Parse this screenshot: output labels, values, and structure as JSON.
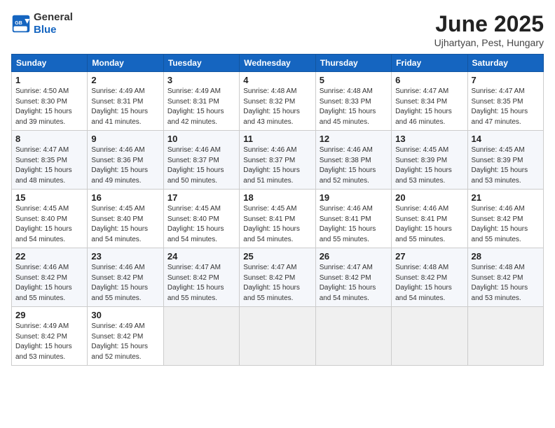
{
  "logo": {
    "text_general": "General",
    "text_blue": "Blue"
  },
  "title": "June 2025",
  "subtitle": "Ujhartyan, Pest, Hungary",
  "weekdays": [
    "Sunday",
    "Monday",
    "Tuesday",
    "Wednesday",
    "Thursday",
    "Friday",
    "Saturday"
  ],
  "weeks": [
    [
      {
        "day": "1",
        "info": "Sunrise: 4:50 AM\nSunset: 8:30 PM\nDaylight: 15 hours\nand 39 minutes."
      },
      {
        "day": "2",
        "info": "Sunrise: 4:49 AM\nSunset: 8:31 PM\nDaylight: 15 hours\nand 41 minutes."
      },
      {
        "day": "3",
        "info": "Sunrise: 4:49 AM\nSunset: 8:31 PM\nDaylight: 15 hours\nand 42 minutes."
      },
      {
        "day": "4",
        "info": "Sunrise: 4:48 AM\nSunset: 8:32 PM\nDaylight: 15 hours\nand 43 minutes."
      },
      {
        "day": "5",
        "info": "Sunrise: 4:48 AM\nSunset: 8:33 PM\nDaylight: 15 hours\nand 45 minutes."
      },
      {
        "day": "6",
        "info": "Sunrise: 4:47 AM\nSunset: 8:34 PM\nDaylight: 15 hours\nand 46 minutes."
      },
      {
        "day": "7",
        "info": "Sunrise: 4:47 AM\nSunset: 8:35 PM\nDaylight: 15 hours\nand 47 minutes."
      }
    ],
    [
      {
        "day": "8",
        "info": "Sunrise: 4:47 AM\nSunset: 8:35 PM\nDaylight: 15 hours\nand 48 minutes."
      },
      {
        "day": "9",
        "info": "Sunrise: 4:46 AM\nSunset: 8:36 PM\nDaylight: 15 hours\nand 49 minutes."
      },
      {
        "day": "10",
        "info": "Sunrise: 4:46 AM\nSunset: 8:37 PM\nDaylight: 15 hours\nand 50 minutes."
      },
      {
        "day": "11",
        "info": "Sunrise: 4:46 AM\nSunset: 8:37 PM\nDaylight: 15 hours\nand 51 minutes."
      },
      {
        "day": "12",
        "info": "Sunrise: 4:46 AM\nSunset: 8:38 PM\nDaylight: 15 hours\nand 52 minutes."
      },
      {
        "day": "13",
        "info": "Sunrise: 4:45 AM\nSunset: 8:39 PM\nDaylight: 15 hours\nand 53 minutes."
      },
      {
        "day": "14",
        "info": "Sunrise: 4:45 AM\nSunset: 8:39 PM\nDaylight: 15 hours\nand 53 minutes."
      }
    ],
    [
      {
        "day": "15",
        "info": "Sunrise: 4:45 AM\nSunset: 8:40 PM\nDaylight: 15 hours\nand 54 minutes."
      },
      {
        "day": "16",
        "info": "Sunrise: 4:45 AM\nSunset: 8:40 PM\nDaylight: 15 hours\nand 54 minutes."
      },
      {
        "day": "17",
        "info": "Sunrise: 4:45 AM\nSunset: 8:40 PM\nDaylight: 15 hours\nand 54 minutes."
      },
      {
        "day": "18",
        "info": "Sunrise: 4:45 AM\nSunset: 8:41 PM\nDaylight: 15 hours\nand 54 minutes."
      },
      {
        "day": "19",
        "info": "Sunrise: 4:46 AM\nSunset: 8:41 PM\nDaylight: 15 hours\nand 55 minutes."
      },
      {
        "day": "20",
        "info": "Sunrise: 4:46 AM\nSunset: 8:41 PM\nDaylight: 15 hours\nand 55 minutes."
      },
      {
        "day": "21",
        "info": "Sunrise: 4:46 AM\nSunset: 8:42 PM\nDaylight: 15 hours\nand 55 minutes."
      }
    ],
    [
      {
        "day": "22",
        "info": "Sunrise: 4:46 AM\nSunset: 8:42 PM\nDaylight: 15 hours\nand 55 minutes."
      },
      {
        "day": "23",
        "info": "Sunrise: 4:46 AM\nSunset: 8:42 PM\nDaylight: 15 hours\nand 55 minutes."
      },
      {
        "day": "24",
        "info": "Sunrise: 4:47 AM\nSunset: 8:42 PM\nDaylight: 15 hours\nand 55 minutes."
      },
      {
        "day": "25",
        "info": "Sunrise: 4:47 AM\nSunset: 8:42 PM\nDaylight: 15 hours\nand 55 minutes."
      },
      {
        "day": "26",
        "info": "Sunrise: 4:47 AM\nSunset: 8:42 PM\nDaylight: 15 hours\nand 54 minutes."
      },
      {
        "day": "27",
        "info": "Sunrise: 4:48 AM\nSunset: 8:42 PM\nDaylight: 15 hours\nand 54 minutes."
      },
      {
        "day": "28",
        "info": "Sunrise: 4:48 AM\nSunset: 8:42 PM\nDaylight: 15 hours\nand 53 minutes."
      }
    ],
    [
      {
        "day": "29",
        "info": "Sunrise: 4:49 AM\nSunset: 8:42 PM\nDaylight: 15 hours\nand 53 minutes."
      },
      {
        "day": "30",
        "info": "Sunrise: 4:49 AM\nSunset: 8:42 PM\nDaylight: 15 hours\nand 52 minutes."
      },
      {
        "day": "",
        "info": ""
      },
      {
        "day": "",
        "info": ""
      },
      {
        "day": "",
        "info": ""
      },
      {
        "day": "",
        "info": ""
      },
      {
        "day": "",
        "info": ""
      }
    ]
  ]
}
